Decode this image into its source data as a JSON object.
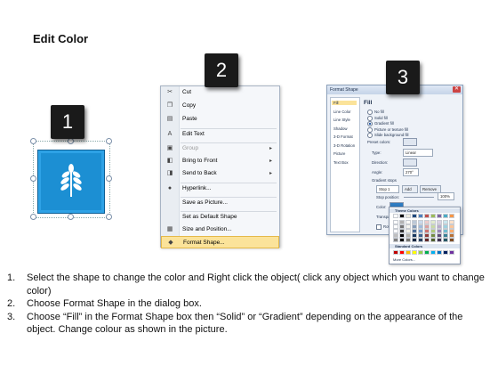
{
  "title": "Edit Color",
  "steps": [
    "1",
    "2",
    "3"
  ],
  "context_menu": {
    "items": [
      {
        "label": "Cut",
        "icon": "scissors-icon",
        "glyph": "✂",
        "disabled": false,
        "submenu": false
      },
      {
        "label": "Copy",
        "icon": "copy-icon",
        "glyph": "❐",
        "disabled": false,
        "submenu": false
      },
      {
        "label": "Paste",
        "icon": "paste-icon",
        "glyph": "▤",
        "disabled": false,
        "submenu": false
      },
      {
        "label": "Edit Text",
        "icon": "edit-text-icon",
        "glyph": "A",
        "disabled": false,
        "submenu": false
      },
      {
        "label": "Group",
        "icon": "group-icon",
        "glyph": "▣",
        "disabled": true,
        "submenu": true
      },
      {
        "label": "Bring to Front",
        "icon": "bring-front-icon",
        "glyph": "◧",
        "disabled": false,
        "submenu": true
      },
      {
        "label": "Send to Back",
        "icon": "send-back-icon",
        "glyph": "◨",
        "disabled": false,
        "submenu": true
      },
      {
        "label": "Hyperlink...",
        "icon": "hyperlink-icon",
        "glyph": "●",
        "disabled": false,
        "submenu": false
      },
      {
        "label": "Save as Picture...",
        "icon": "",
        "glyph": "",
        "disabled": false,
        "submenu": false
      },
      {
        "label": "Set as Default Shape",
        "icon": "",
        "glyph": "",
        "disabled": false,
        "submenu": false
      },
      {
        "label": "Size and Position...",
        "icon": "size-position-icon",
        "glyph": "▦",
        "disabled": false,
        "submenu": false
      },
      {
        "label": "Format Shape...",
        "icon": "format-shape-icon",
        "glyph": "◆",
        "disabled": false,
        "submenu": false,
        "highlighted": true
      }
    ]
  },
  "dialog": {
    "title": "Format Shape",
    "categories": [
      "Fill",
      "Line Color",
      "Line Style",
      "Shadow",
      "3-D Format",
      "3-D Rotation",
      "Picture",
      "Text Box"
    ],
    "heading": "Fill",
    "options": [
      "No fill",
      "Solid fill",
      "Gradient fill",
      "Picture or texture fill",
      "Slide background fill"
    ],
    "fields": {
      "preset": "Preset colors:",
      "type": "Type:",
      "type_value": "Linear",
      "direction": "Direction:",
      "angle": "Angle:",
      "angle_value": "270°",
      "gradient_stops": "Gradient stops",
      "stop": "Stop 1",
      "add": "Add",
      "remove": "Remove",
      "stop_position": "Stop position:",
      "stop_position_value": "100%",
      "color": "Color:",
      "transparency": "Transpa",
      "rotate": "Rotate"
    },
    "palette": {
      "theme_header": "Theme Colors",
      "standard_header": "Standard Colors",
      "more": "More Colors..."
    }
  },
  "colors": {
    "theme_top": [
      "#ffffff",
      "#000000",
      "#eeece1",
      "#1f497d",
      "#4f81bd",
      "#c0504d",
      "#9bbb59",
      "#8064a2",
      "#4bacc6",
      "#f79646"
    ],
    "standard": [
      "#c00000",
      "#ff0000",
      "#ffc000",
      "#ffff00",
      "#92d050",
      "#00b050",
      "#00b0f0",
      "#0070c0",
      "#002060",
      "#7030a0"
    ]
  },
  "instructions": [
    {
      "n": "1.",
      "text": "Select the shape to change the color and Right click the object( click any object which you want to change color)"
    },
    {
      "n": "2.",
      "text": "Choose Format Shape in the dialog box."
    },
    {
      "n": "3.",
      "text": "Choose “Fill” in the Format Shape box then “Solid” or “Gradient” depending on the appearance of the object. Change colour as shown in the picture."
    }
  ]
}
